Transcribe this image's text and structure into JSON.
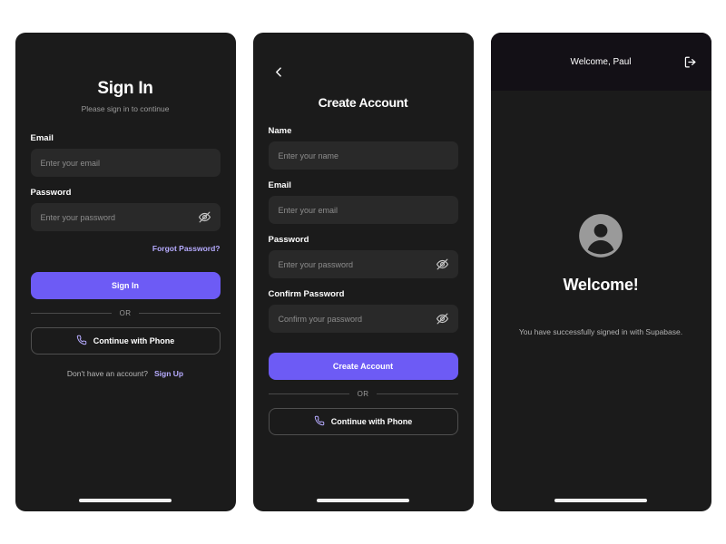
{
  "theme": {
    "page_background": "#ffffff",
    "panel_background": "#1b1b1b",
    "input_background": "#292929",
    "accent": "#6d5bf5",
    "link": "#b6abff",
    "appbar_background": "#131016",
    "muted_text": "#9b9b9b"
  },
  "signin": {
    "title": "Sign In",
    "subtitle": "Please sign in to continue",
    "email_label": "Email",
    "email_placeholder": "Enter your email",
    "email_value": "",
    "password_label": "Password",
    "password_placeholder": "Enter your password",
    "password_value": "",
    "forgot_password": "Forgot Password?",
    "submit_label": "Sign In",
    "divider_label": "OR",
    "phone_label": "Continue with Phone",
    "signup_prompt": "Don't have an account?",
    "signup_link": "Sign Up",
    "icons": {
      "password_toggle": "eye-off-icon",
      "phone": "phone-icon"
    }
  },
  "signup": {
    "back_icon": "chevron-left-icon",
    "title": "Create Account",
    "name_label": "Name",
    "name_placeholder": "Enter your name",
    "name_value": "",
    "email_label": "Email",
    "email_placeholder": "Enter your email",
    "email_value": "",
    "password_label": "Password",
    "password_placeholder": "Enter your password",
    "password_value": "",
    "confirm_label": "Confirm Password",
    "confirm_placeholder": "Confirm your password",
    "confirm_value": "",
    "submit_label": "Create Account",
    "divider_label": "OR",
    "phone_label": "Continue with Phone",
    "icons": {
      "password_toggle": "eye-off-icon",
      "confirm_toggle": "eye-off-icon",
      "phone": "phone-icon"
    }
  },
  "welcome": {
    "appbar_title": "Welcome, Paul",
    "logout_icon": "logout-icon",
    "avatar_icon": "user-avatar-icon",
    "heading": "Welcome!",
    "message": "You have successfully signed in with Supabase."
  }
}
